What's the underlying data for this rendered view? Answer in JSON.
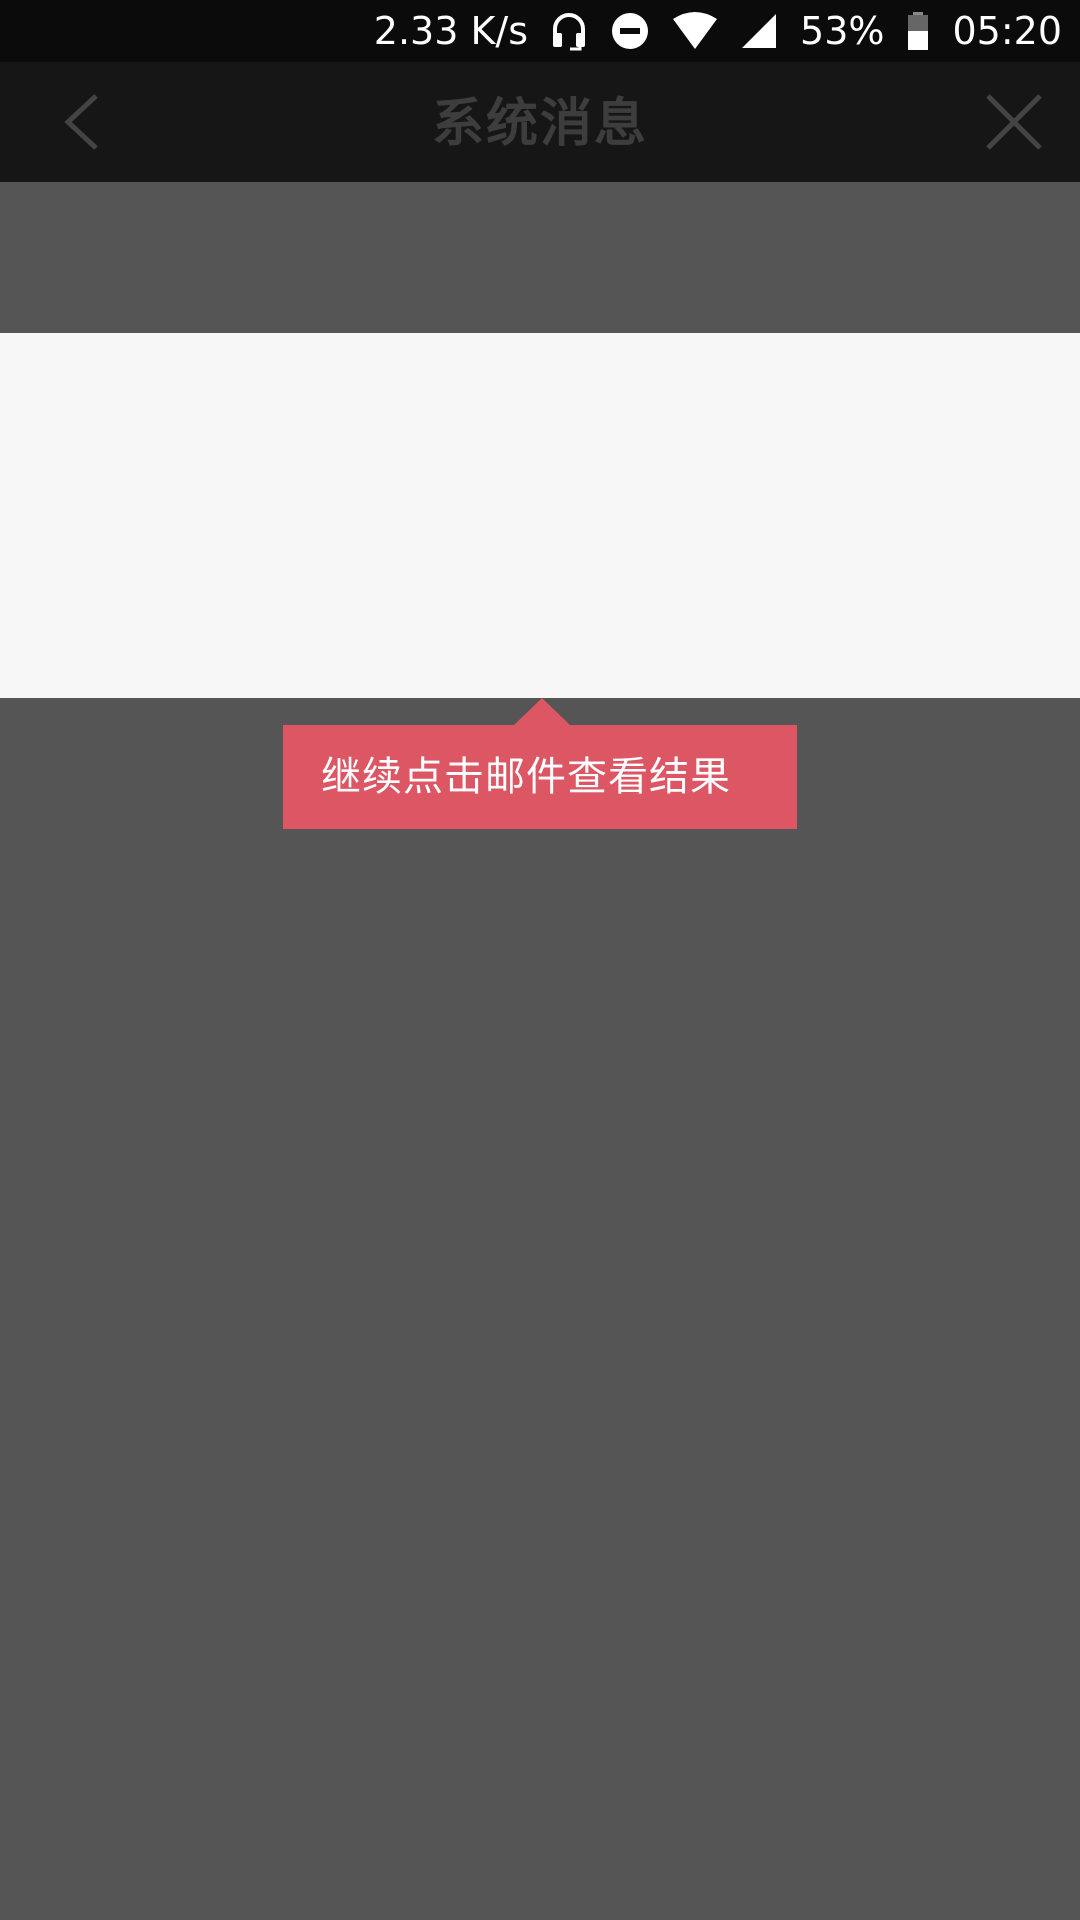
{
  "status_bar": {
    "speed": "2.33 K/s",
    "battery": "53%",
    "time": "05:20",
    "icons": [
      "headset-icon",
      "do-not-disturb-icon",
      "wifi-icon",
      "signal-icon",
      "battery-icon"
    ]
  },
  "nav": {
    "title": "系统消息",
    "back_icon": "chevron-left-icon",
    "close_icon": "close-icon"
  },
  "tooltip": {
    "text": "继续点击邮件查看结果",
    "color": "#dc5664"
  },
  "colors": {
    "overlay": "#555555",
    "highlight": "#f7f7f7",
    "status_bar": "#0b0b0b",
    "nav_bar": "#161616"
  }
}
